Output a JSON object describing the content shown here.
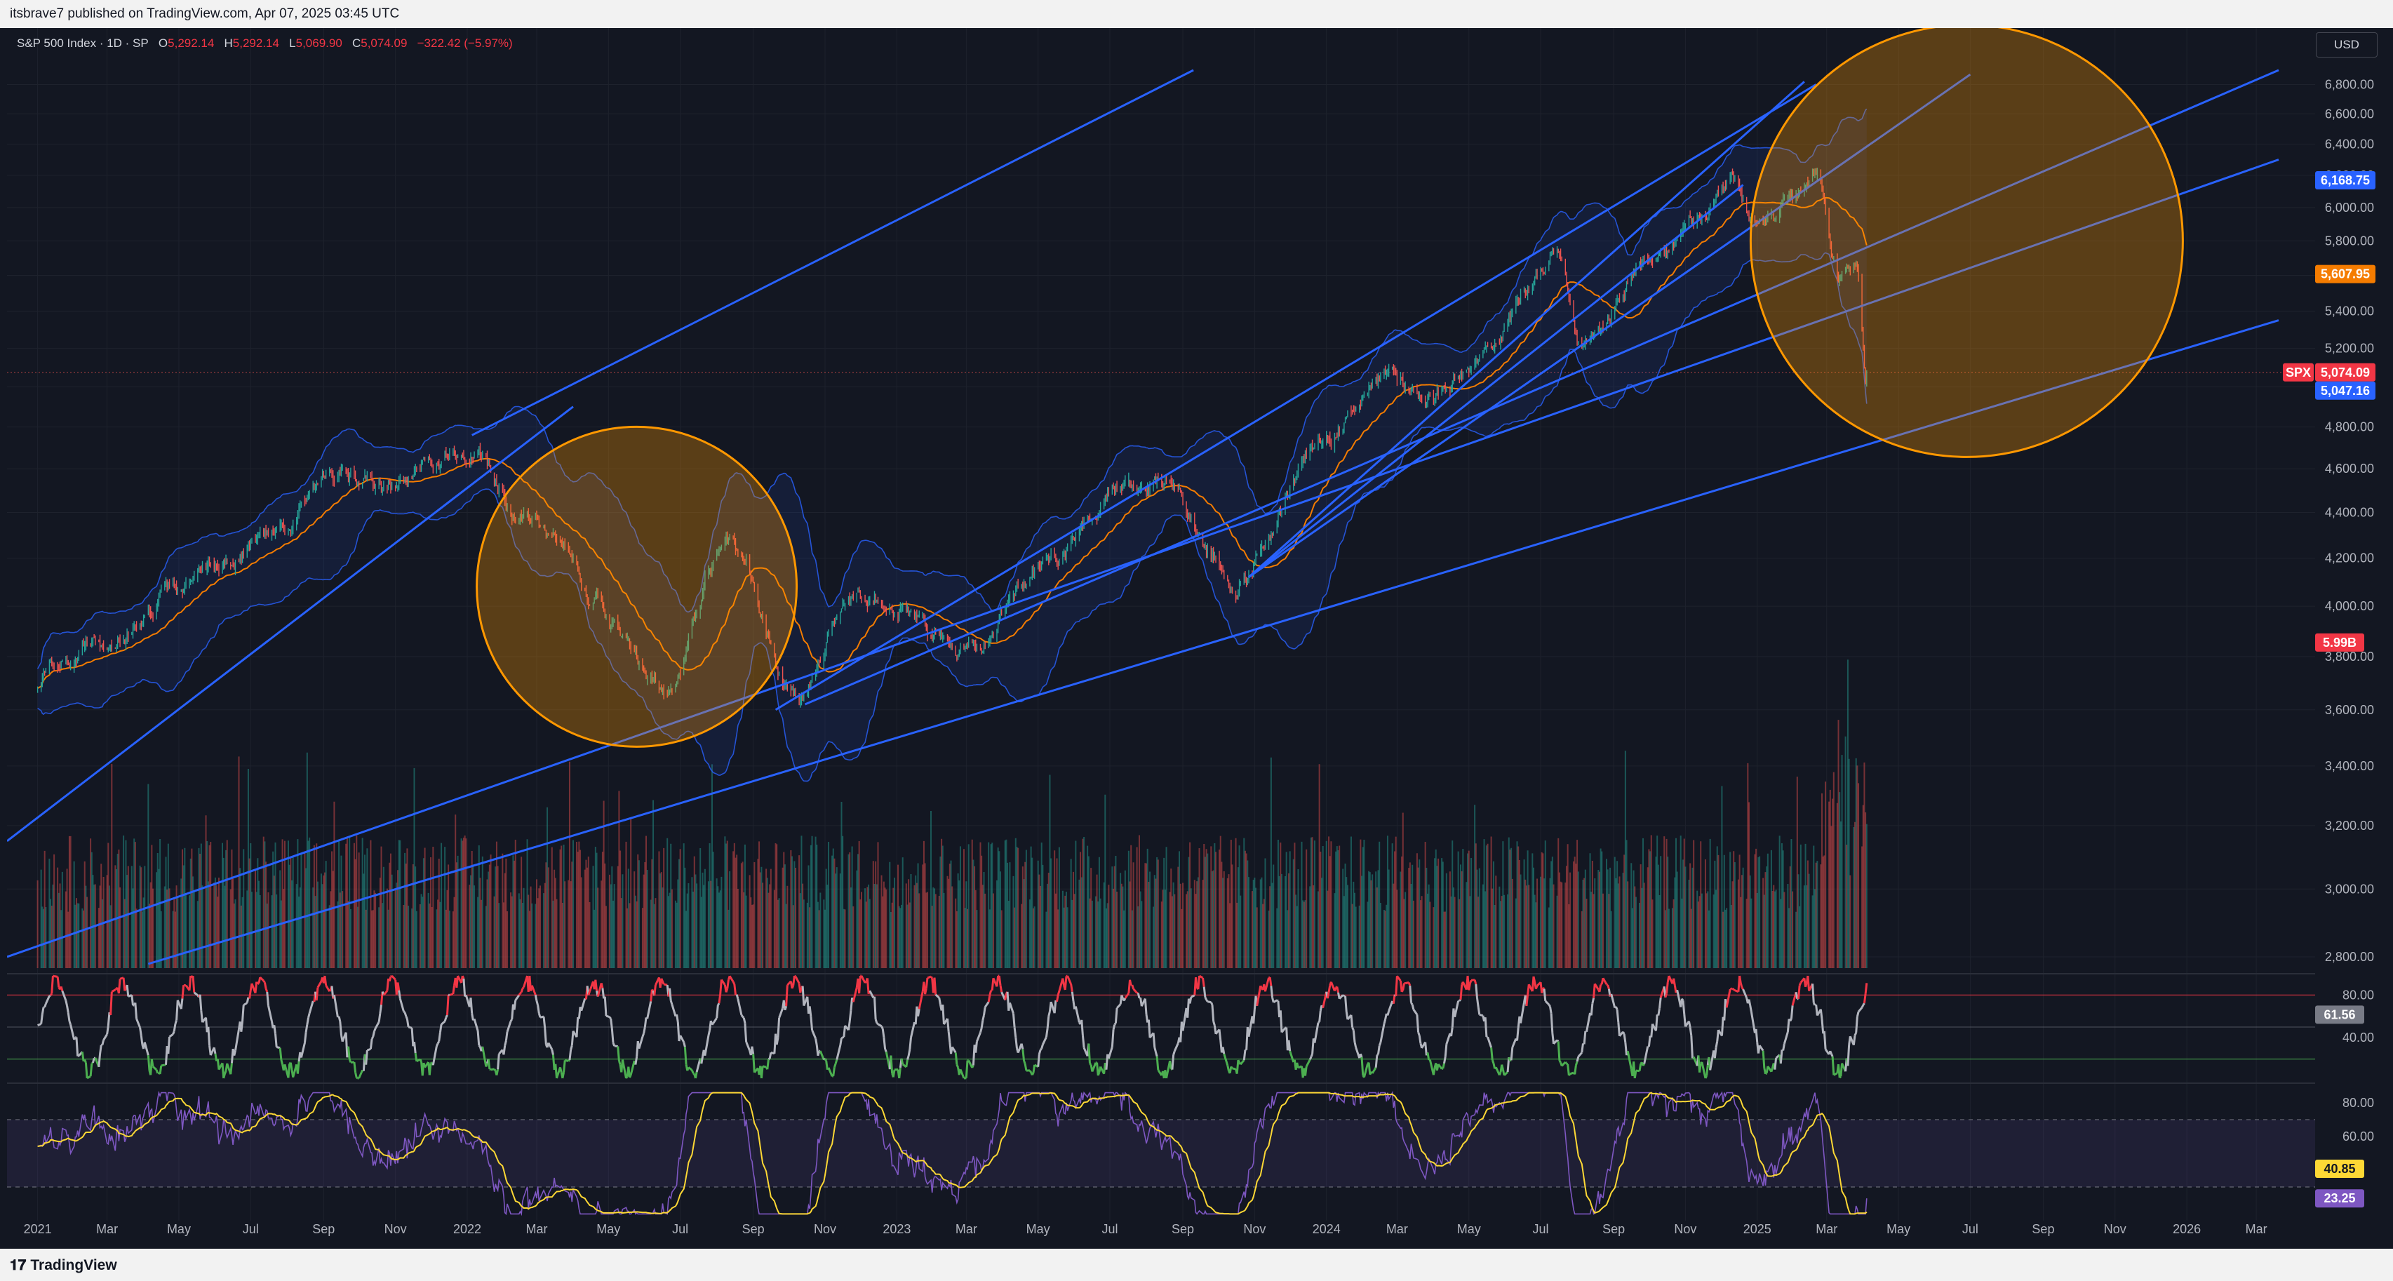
{
  "header": {
    "text": "itsbrave7 published on TradingView.com, Apr 07, 2025 03:45 UTC"
  },
  "footer": {
    "brand": "TradingView",
    "logo_icon": "tradingview-logo-icon"
  },
  "currency_button": "USD",
  "ohlc": {
    "symbol": "S&P 500 Index · 1D · SP",
    "o_label": "O",
    "o": "5,292.14",
    "h_label": "H",
    "h": "5,292.14",
    "l_label": "L",
    "l": "5,069.90",
    "c_label": "C",
    "c": "5,074.09",
    "change": "−322.42 (−5.97%)"
  },
  "colors": {
    "background": "#131722",
    "trendline": "#2962ff",
    "circle": "#ff9800",
    "bands": "#2962ff",
    "ma": "#f57c00",
    "candle_up": "#26a69a",
    "candle_down": "#ef5350",
    "stoch_high": "#f23645",
    "stoch_low": "#4caf50",
    "stoch_mid": "#b2b5be",
    "rsi": "#7e57c2",
    "rsi_ma": "#fdd835"
  },
  "chart_data": [
    {
      "type": "line",
      "panel": "price",
      "scale": "log",
      "ylim": [
        2700,
        7000
      ],
      "y_ticks": [
        "6,800.00",
        "6,600.00",
        "6,400.00",
        "6,200.00",
        "6,000.00",
        "5,800.00",
        "5,600.00",
        "5,400.00",
        "5,200.00",
        "5,000.00",
        "4,800.00",
        "4,600.00",
        "4,400.00",
        "4,200.00",
        "4,000.00",
        "3,800.00",
        "3,600.00",
        "3,400.00",
        "3,200.00",
        "3,000.00",
        "2,800.00"
      ],
      "x_ticks": [
        "2021",
        "Mar",
        "May",
        "Jul",
        "Sep",
        "Nov",
        "2022",
        "Mar",
        "May",
        "Jul",
        "Sep",
        "Nov",
        "2023",
        "Mar",
        "May",
        "Jul",
        "Sep",
        "Nov",
        "2024",
        "Mar",
        "May",
        "Jul",
        "Sep",
        "Nov",
        "2025",
        "Mar",
        "May",
        "Jul",
        "Sep",
        "Nov",
        "2026",
        "Mar"
      ],
      "x": [
        "2021-01-01",
        "2021-03-01",
        "2021-06-01",
        "2021-09-01",
        "2021-12-01",
        "2022-01-01",
        "2022-03-01",
        "2022-06-15",
        "2022-08-15",
        "2022-10-10",
        "2022-12-01",
        "2023-03-10",
        "2023-05-01",
        "2023-07-31",
        "2023-10-27",
        "2023-12-29",
        "2024-03-01",
        "2024-04-19",
        "2024-07-16",
        "2024-08-05",
        "2024-10-01",
        "2024-12-06",
        "2025-01-01",
        "2025-02-19",
        "2025-03-13",
        "2025-03-26",
        "2025-04-04"
      ],
      "series": [
        {
          "values": [
            3700,
            3850,
            4200,
            4450,
            4600,
            4780,
            4300,
            3680,
            4300,
            3580,
            4080,
            3850,
            4150,
            4590,
            4120,
            4770,
            5130,
            4970,
            5660,
            5190,
            5740,
            6090,
            5880,
            6140,
            5520,
            5700,
            5074
          ]
        }
      ],
      "labels": {
        "upper_band": "6,168.75",
        "ma": "5,607.95",
        "symbol_tag": "SPX",
        "last_price": "5,074.09",
        "lower_band": "5,047.16",
        "volume": "5.99B"
      }
    },
    {
      "type": "line",
      "panel": "stochastic",
      "ylim": [
        0,
        100
      ],
      "y_ticks": [
        "80.00",
        "40.00"
      ],
      "upper_level": 80,
      "lower_level": 20,
      "value_label": "61.56"
    },
    {
      "type": "line",
      "panel": "rsi",
      "ylim": [
        10,
        90
      ],
      "y_ticks": [
        "80.00",
        "60.00"
      ],
      "band": [
        30,
        70
      ],
      "labels": {
        "ma": "40.85",
        "rsi": "23.25"
      }
    }
  ]
}
